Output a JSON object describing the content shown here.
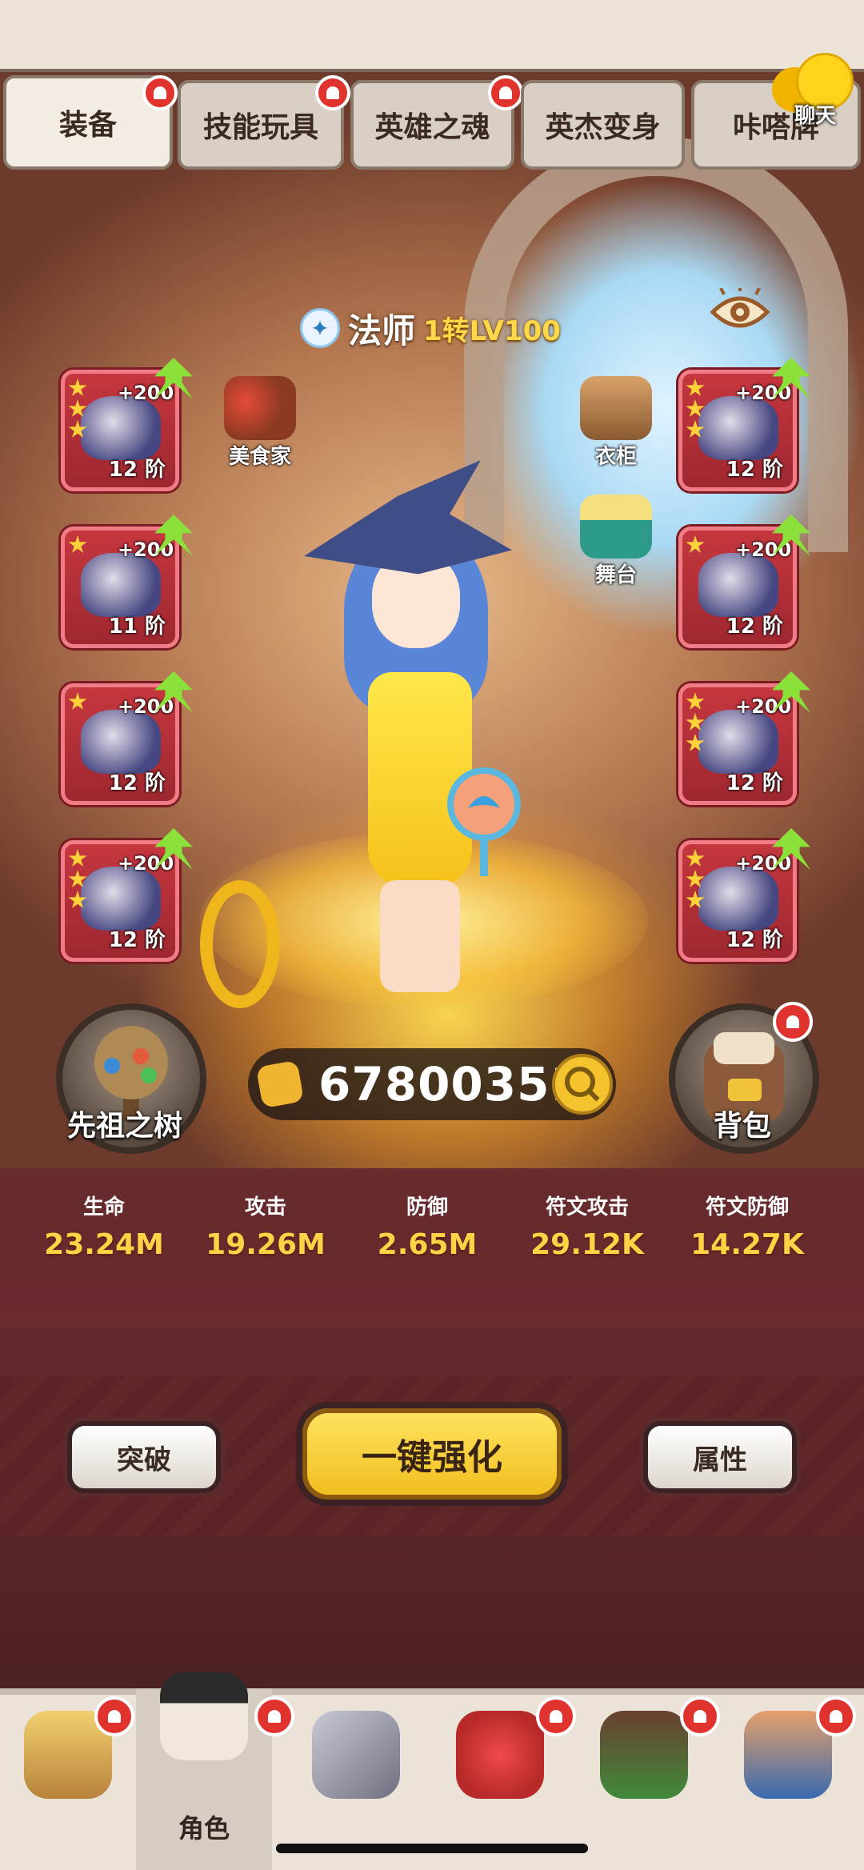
{
  "tabs": [
    {
      "label": "装备",
      "active": true
    },
    {
      "label": "技能玩具"
    },
    {
      "label": "英雄之魂"
    },
    {
      "label": "英杰变身"
    },
    {
      "label": "咔嗒牌"
    }
  ],
  "chat_label": "聊天",
  "hero": {
    "class_name": "法师",
    "level": "1转LV100"
  },
  "left_slots": [
    {
      "bonus": "+200",
      "rank": "12 阶"
    },
    {
      "bonus": "+200",
      "rank": "11 阶"
    },
    {
      "bonus": "+200",
      "rank": "12 阶"
    },
    {
      "bonus": "+200",
      "rank": "12 阶"
    }
  ],
  "right_slots": [
    {
      "bonus": "+200",
      "rank": "12 阶"
    },
    {
      "bonus": "+200",
      "rank": "12 阶"
    },
    {
      "bonus": "+200",
      "rank": "12 阶"
    },
    {
      "bonus": "+200",
      "rank": "12 阶"
    }
  ],
  "props": {
    "gourmet": "美食家",
    "wardrobe": "衣柜",
    "stage": "舞台"
  },
  "ancestor_tree_label": "先祖之树",
  "backpack_label": "背包",
  "power_value": "67800351",
  "stats": [
    {
      "label": "生命",
      "value": "23.24M"
    },
    {
      "label": "攻击",
      "value": "19.26M"
    },
    {
      "label": "防御",
      "value": "2.65M"
    },
    {
      "label": "符文攻击",
      "value": "29.12K"
    },
    {
      "label": "符文防御",
      "value": "14.27K"
    }
  ],
  "actions": {
    "breakthrough": "突破",
    "one_click_enhance": "一键强化",
    "attributes": "属性"
  },
  "bottom_nav": [
    {
      "label": ""
    },
    {
      "label": "角色",
      "active": true
    },
    {
      "label": ""
    },
    {
      "label": ""
    },
    {
      "label": ""
    },
    {
      "label": ""
    }
  ],
  "colors": {
    "accent_gold": "#ffd345",
    "slot_red": "#c6373f",
    "panel": "#5a2a2c",
    "alert_red": "#e0332e"
  }
}
